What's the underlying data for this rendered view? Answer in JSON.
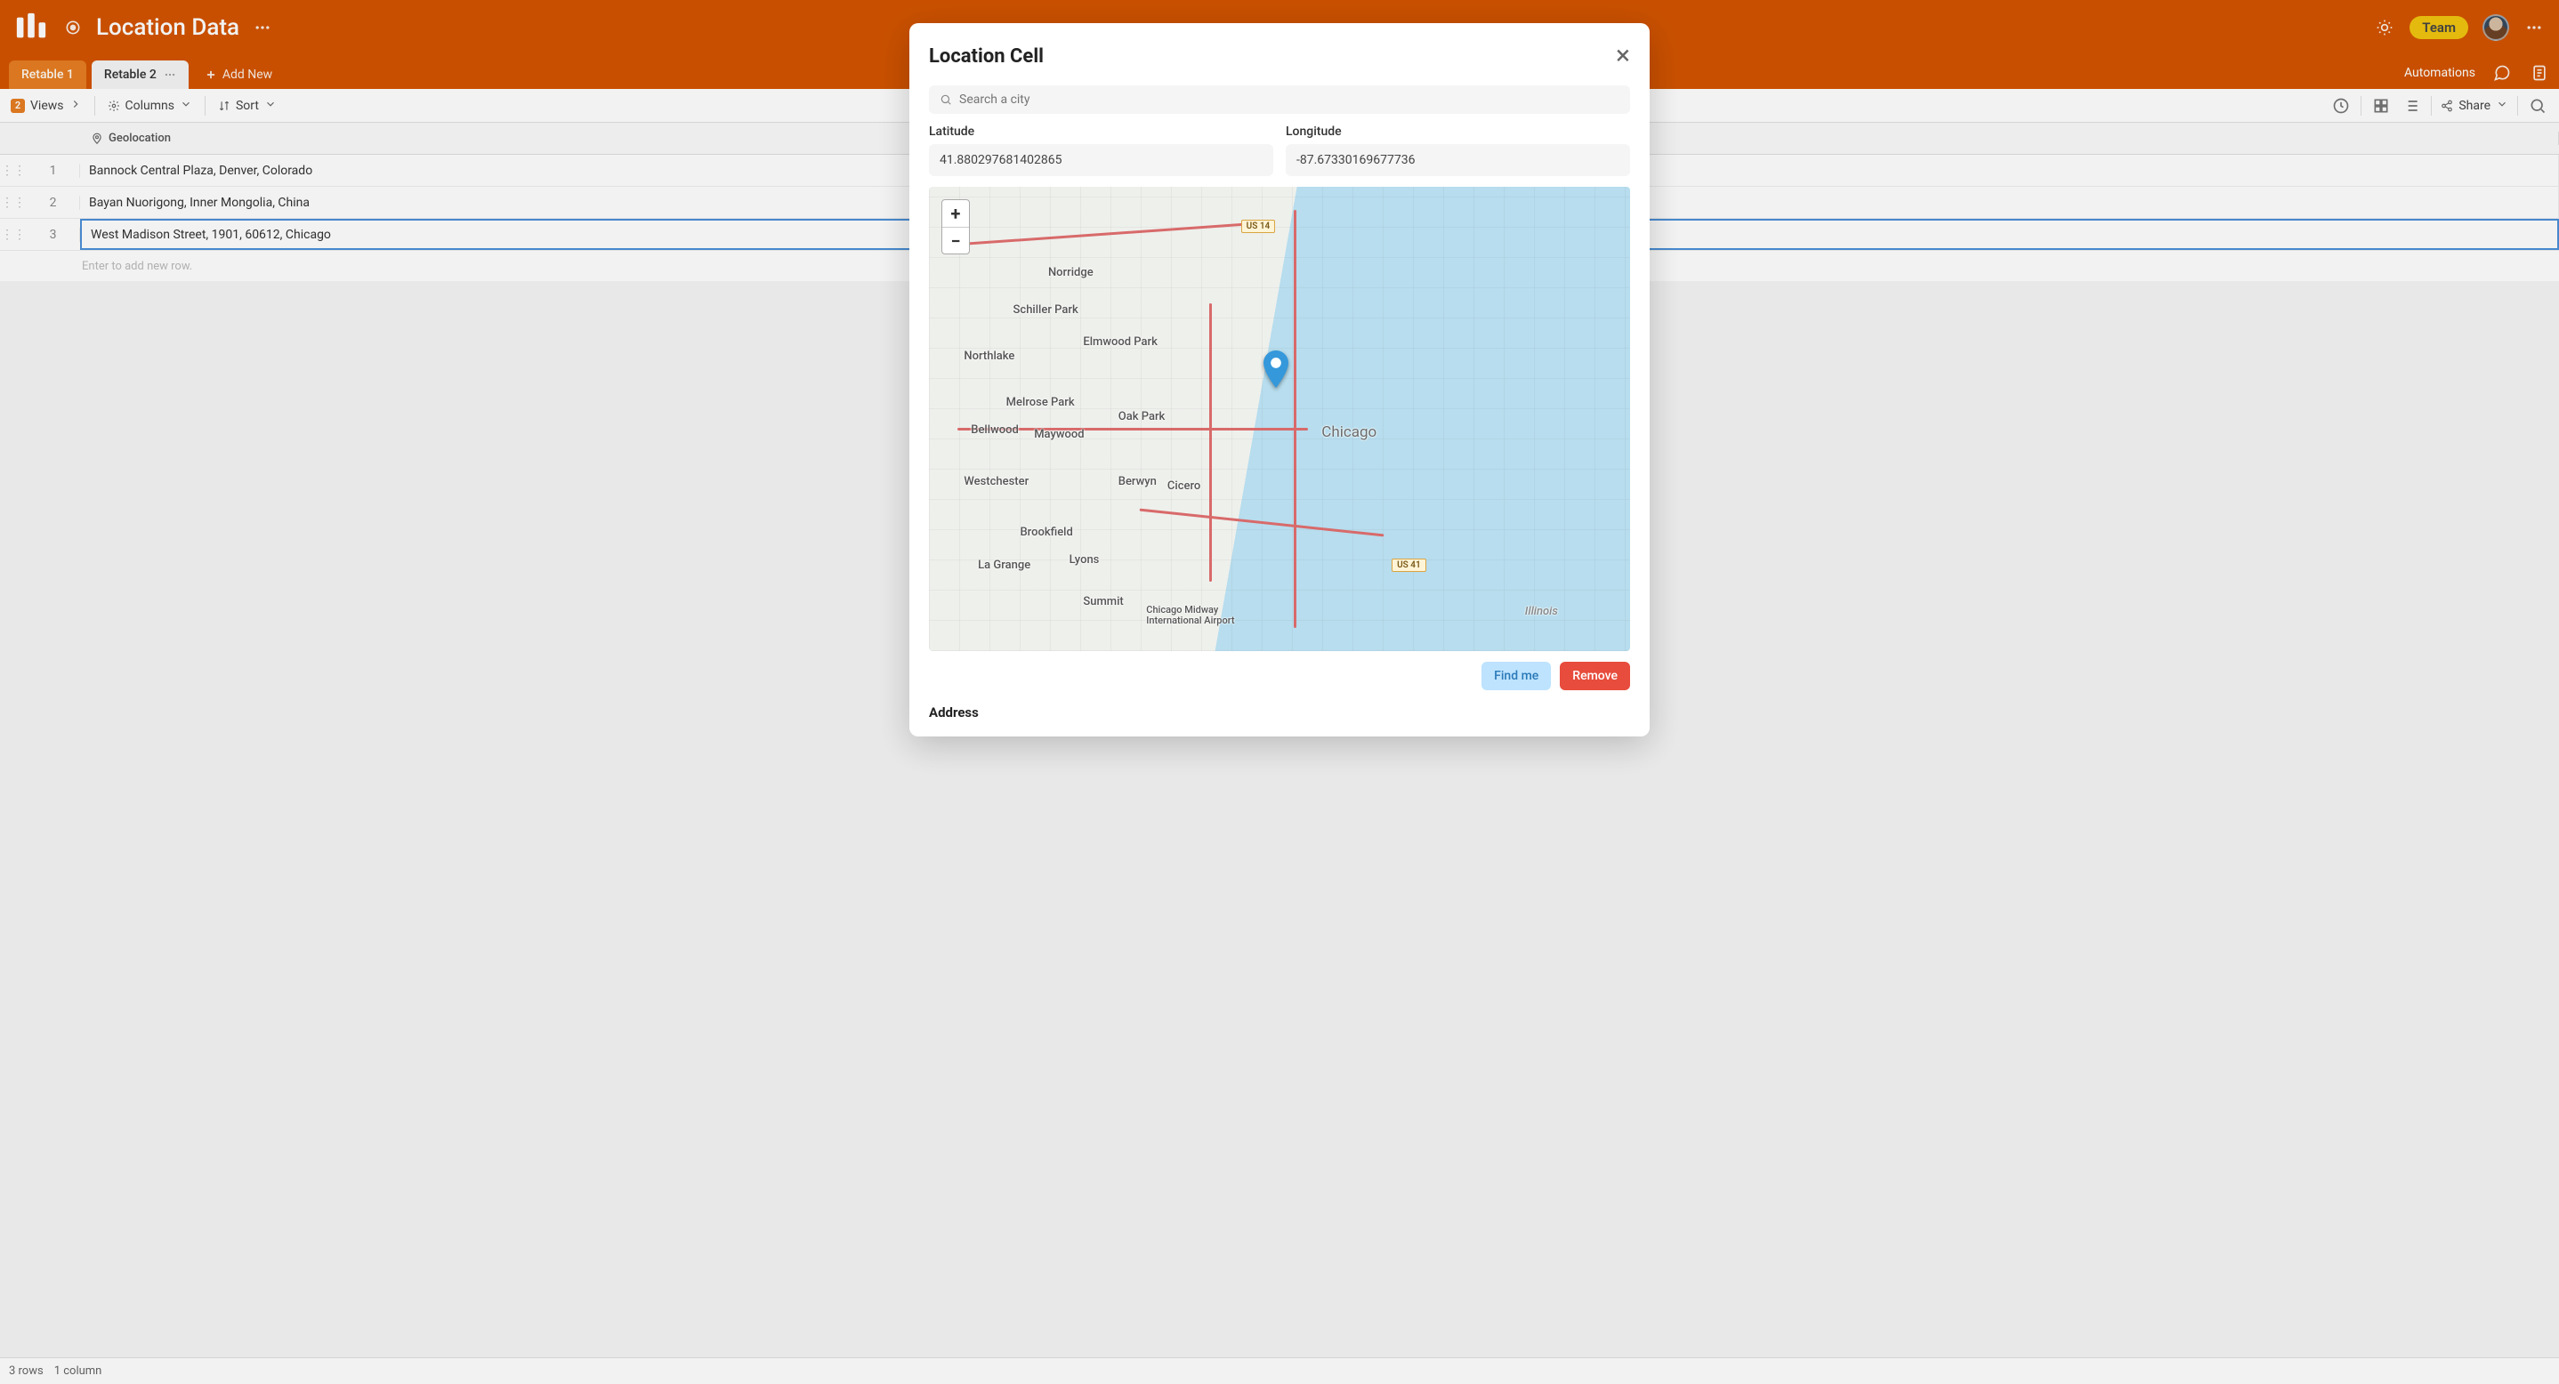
{
  "header": {
    "page_title": "Location Data",
    "team_badge": "Team",
    "automations_label": "Automations"
  },
  "tabs": {
    "items": [
      {
        "label": "Retable 1",
        "active": false
      },
      {
        "label": "Retable 2",
        "active": true
      }
    ],
    "add_new_label": "Add New"
  },
  "toolbar": {
    "views_count": "2",
    "views_label": "Views",
    "columns_label": "Columns",
    "sort_label": "Sort",
    "share_label": "Share"
  },
  "grid": {
    "column_header": "Geolocation",
    "rows": [
      {
        "num": "1",
        "value": "Bannock Central Plaza, Denver, Colorado"
      },
      {
        "num": "2",
        "value": "Bayan Nuorigong, Inner Mongolia, China"
      },
      {
        "num": "3",
        "value": "West Madison Street, 1901, 60612, Chicago"
      }
    ],
    "placeholder": "Enter to add new row."
  },
  "footer": {
    "rows_text": "3 rows",
    "cols_text": "1 column"
  },
  "modal": {
    "title": "Location Cell",
    "search_placeholder": "Search a city",
    "latitude_label": "Latitude",
    "longitude_label": "Longitude",
    "latitude_value": "41.880297681402865",
    "longitude_value": "-87.67330169677736",
    "find_me_label": "Find me",
    "remove_label": "Remove",
    "address_label": "Address",
    "map_city_label": "Chicago",
    "map_places": {
      "norridge": "Norridge",
      "schiller": "Schiller Park",
      "elmwood": "Elmwood Park",
      "northlake": "Northlake",
      "melrose": "Melrose Park",
      "bellwood": "Bellwood",
      "maywood": "Maywood",
      "oakpark": "Oak Park",
      "westchester": "Westchester",
      "berwyn": "Berwyn",
      "cicero": "Cicero",
      "lagrange": "La Grange",
      "brookfield": "Brookfield",
      "lyons": "Lyons",
      "summit": "Summit",
      "midway": "Chicago Midway International Airport",
      "illinois": "Illinois"
    },
    "road_us14": "US 14",
    "road_us41": "US 41",
    "zoom_in": "+",
    "zoom_out": "−"
  }
}
